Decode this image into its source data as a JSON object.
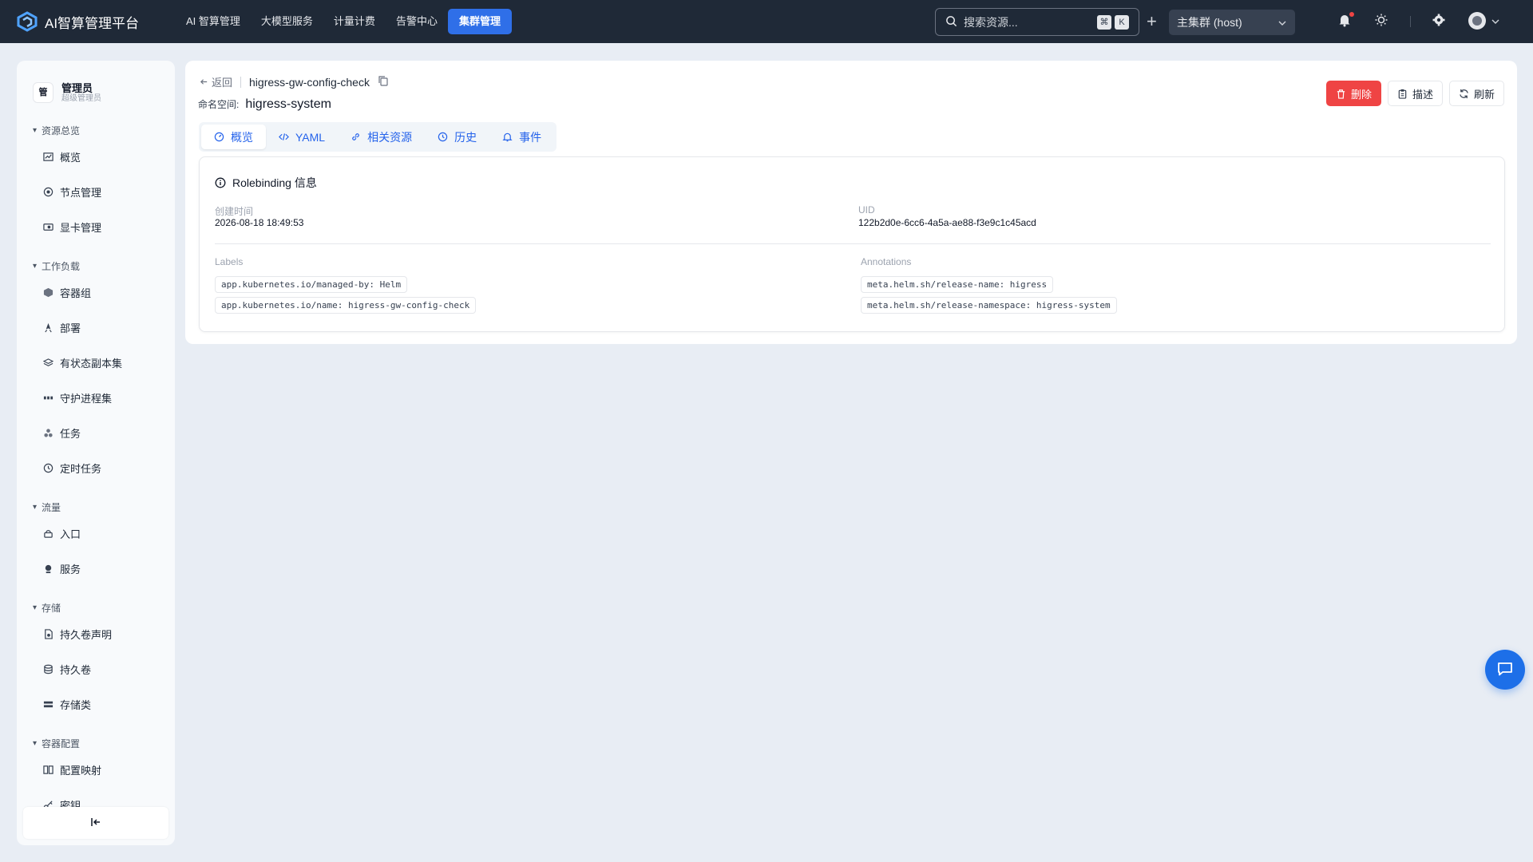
{
  "app": {
    "title": "AI智算管理平台"
  },
  "nav": {
    "items": [
      {
        "label": "AI 智算管理"
      },
      {
        "label": "大模型服务"
      },
      {
        "label": "计量计费"
      },
      {
        "label": "告警中心"
      },
      {
        "label": "集群管理"
      }
    ],
    "active_index": 4
  },
  "search": {
    "placeholder": "搜索资源...",
    "shortcut_keys": [
      "⌘",
      "K"
    ]
  },
  "cluster_select": {
    "value": "主集群 (host)"
  },
  "sidebar": {
    "user": {
      "avatar": "管",
      "name": "管理员",
      "role": "超级管理员"
    },
    "sections": [
      {
        "title": "资源总览",
        "items": [
          {
            "label": "概览",
            "icon": "chart-icon"
          },
          {
            "label": "节点管理",
            "icon": "node-icon"
          },
          {
            "label": "显卡管理",
            "icon": "gpu-icon"
          }
        ]
      },
      {
        "title": "工作负载",
        "items": [
          {
            "label": "容器组",
            "icon": "cube-icon"
          },
          {
            "label": "部署",
            "icon": "rocket-icon"
          },
          {
            "label": "有状态副本集",
            "icon": "layers-icon"
          },
          {
            "label": "守护进程集",
            "icon": "daemon-icon"
          },
          {
            "label": "任务",
            "icon": "job-icon"
          },
          {
            "label": "定时任务",
            "icon": "clock-icon"
          }
        ]
      },
      {
        "title": "流量",
        "items": [
          {
            "label": "入口",
            "icon": "ingress-icon"
          },
          {
            "label": "服务",
            "icon": "service-icon"
          }
        ]
      },
      {
        "title": "存储",
        "items": [
          {
            "label": "持久卷声明",
            "icon": "pvc-icon"
          },
          {
            "label": "持久卷",
            "icon": "database-icon"
          },
          {
            "label": "存储类",
            "icon": "storage-class-icon"
          }
        ]
      },
      {
        "title": "容器配置",
        "items": [
          {
            "label": "配置映射",
            "icon": "configmap-icon"
          },
          {
            "label": "密钥",
            "icon": "key-icon"
          }
        ]
      }
    ]
  },
  "detail": {
    "back_label": "返回",
    "resource_name": "higress-gw-config-check",
    "namespace_label": "命名空间:",
    "namespace": "higress-system",
    "actions": {
      "delete": "删除",
      "describe": "描述",
      "refresh": "刷新"
    },
    "tabs": [
      {
        "label": "概览"
      },
      {
        "label": "YAML"
      },
      {
        "label": "相关资源"
      },
      {
        "label": "历史"
      },
      {
        "label": "事件"
      }
    ],
    "active_tab": 0,
    "card": {
      "title": "Rolebinding 信息",
      "created_label": "创建时间",
      "created_value": "2026-08-18 18:49:53",
      "uid_label": "UID",
      "uid_value": "122b2d0e-6cc6-4a5a-ae88-f3e9c1c45acd",
      "labels_title": "Labels",
      "labels": [
        "app.kubernetes.io/managed-by: Helm",
        "app.kubernetes.io/name: higress-gw-config-check"
      ],
      "annotations_title": "Annotations",
      "annotations": [
        "meta.helm.sh/release-name: higress",
        "meta.helm.sh/release-namespace: higress-system"
      ]
    }
  },
  "colors": {
    "topbar": "#1f2937",
    "accent": "#2f6fe8",
    "danger": "#ef4444",
    "background": "#e8edf4"
  }
}
